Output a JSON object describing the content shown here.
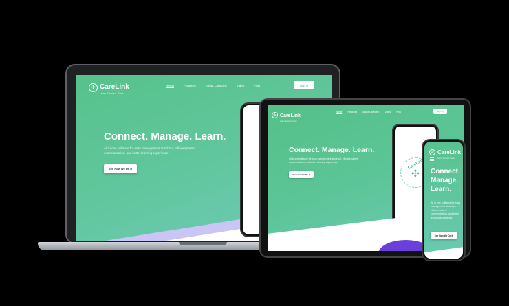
{
  "brand": {
    "name": "CareLink",
    "tagline": "Learn. Connect. Grow."
  },
  "nav": {
    "items": [
      "Home",
      "Features",
      "About CareLink",
      "Video",
      "FAQ"
    ],
    "signin_label": "Sign In"
  },
  "hero": {
    "title": "Connect. Manage. Learn.",
    "mobile_title_lines": [
      "Connect.",
      "Manage.",
      "Learn."
    ],
    "description": "All in one software for easy management at school, efficient parent communication, and better learning experience.",
    "cta_label": "See How We Do It"
  },
  "badge": {
    "arc_text": "CareLink"
  },
  "colors": {
    "gradient_start": "#57c28c",
    "gradient_end": "#6fcab9",
    "accent_purple": "#6b3fd9",
    "background": "#000000"
  }
}
